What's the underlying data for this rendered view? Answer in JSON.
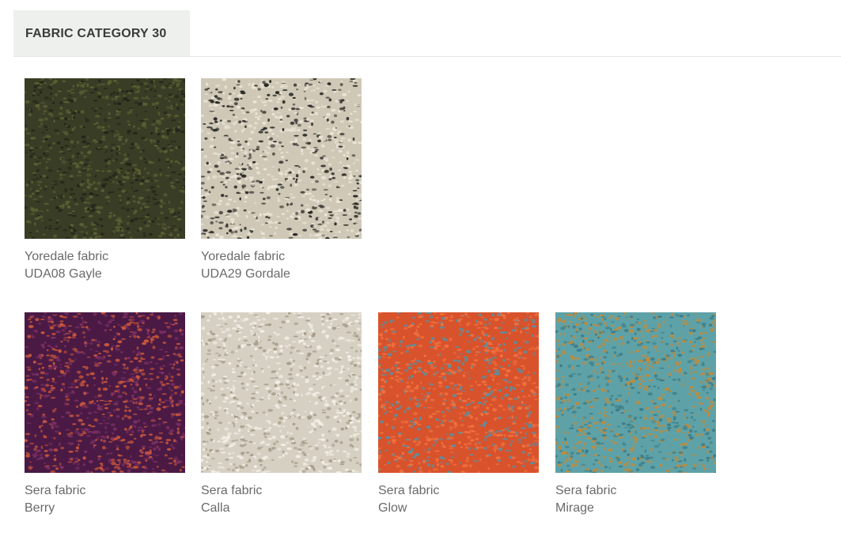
{
  "category": {
    "title": "FABRIC CATEGORY 30"
  },
  "swatches": [
    {
      "line1": "Yoredale fabric",
      "line2": "UDA08 Gayle",
      "base": "#3a3d25",
      "fleck": "#5a6034",
      "accent": "#23251a"
    },
    {
      "line1": "Yoredale fabric",
      "line2": "UDA29 Gordale",
      "base": "#cfc8b6",
      "fleck": "#ebe6d8",
      "accent": "#2a2a26"
    },
    {
      "line1": "Sera fabric",
      "line2": "Berry",
      "base": "#4a1a45",
      "fleck": "#c8573a",
      "accent": "#7b2f62"
    },
    {
      "line1": "Sera fabric",
      "line2": "Calla",
      "base": "#d6d0c3",
      "fleck": "#f3efe6",
      "accent": "#a79d8a"
    },
    {
      "line1": "Sera fabric",
      "line2": "Glow",
      "base": "#d8522c",
      "fleck": "#f07340",
      "accent": "#5a8fa0"
    },
    {
      "line1": "Sera fabric",
      "line2": "Mirage",
      "base": "#5ea2a8",
      "fleck": "#c18a3a",
      "accent": "#3d7c86"
    }
  ]
}
